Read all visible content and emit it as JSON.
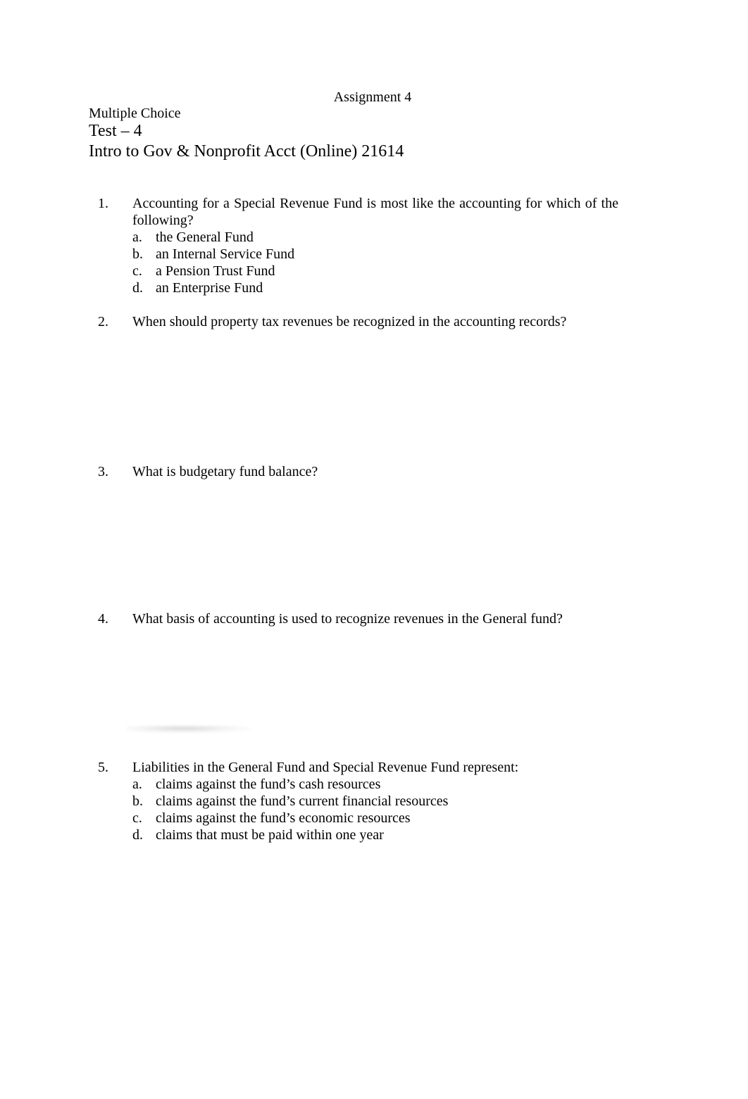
{
  "document": {
    "title": "Assignment 4",
    "subtitle": "Multiple Choice",
    "test_label": "Test – 4",
    "course": "Intro to Gov & Nonprofit Acct (Online) 21614"
  },
  "questions": [
    {
      "number": "1.",
      "text": "Accounting for a Special Revenue Fund is most like the accounting for which of the following?",
      "options": [
        {
          "letter": "a.",
          "text": "the General Fund"
        },
        {
          "letter": "b.",
          "text": "an Internal Service Fund"
        },
        {
          "letter": "c.",
          "text": "a Pension Trust Fund"
        },
        {
          "letter": "d.",
          "text": "an Enterprise Fund"
        }
      ]
    },
    {
      "number": "2.",
      "text": "When should property tax revenues be recognized in the accounting records?",
      "options": []
    },
    {
      "number": "3.",
      "text": "What is budgetary fund balance?",
      "options": []
    },
    {
      "number": "4.",
      "text": "What basis of accounting is used to recognize revenues in the General fund?",
      "options": []
    },
    {
      "number": "5.",
      "text": "Liabilities in the General Fund and Special Revenue Fund represent:",
      "options": [
        {
          "letter": "a.",
          "text": "claims against the fund’s cash resources"
        },
        {
          "letter": "b.",
          "text": "claims against the fund’s current financial resources"
        },
        {
          "letter": "c.",
          "text": "claims against the fund’s economic resources"
        },
        {
          "letter": "d.",
          "text": "claims that must be paid within one year"
        }
      ]
    }
  ]
}
